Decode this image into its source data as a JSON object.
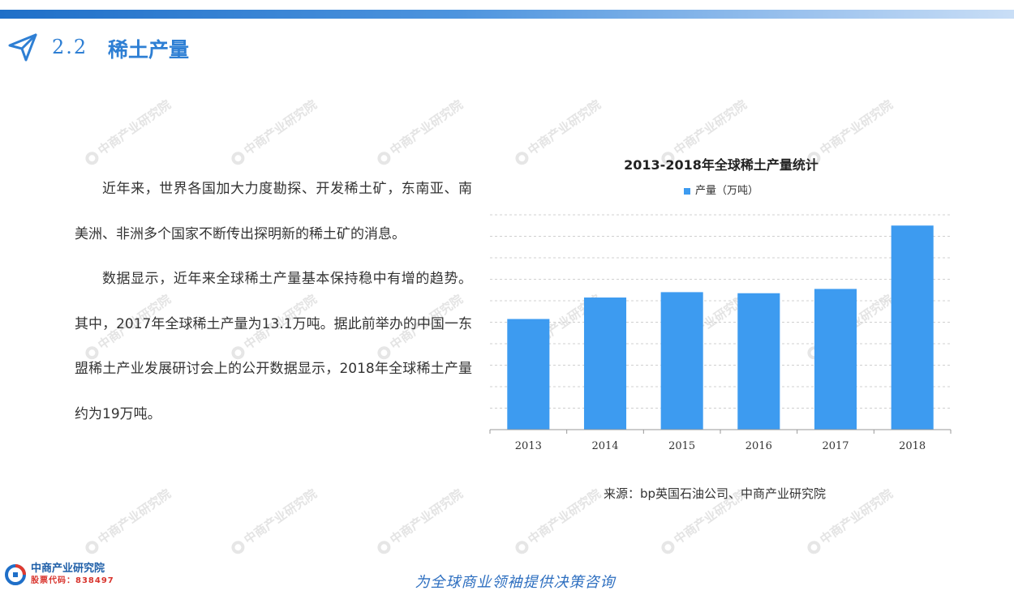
{
  "header": {
    "section_number": "2.2",
    "section_title": "稀土产量"
  },
  "body": {
    "paragraphs": [
      "近年来，世界各国加大力度勘探、开发稀土矿，东南亚、南美洲、非洲多个国家不断传出探明新的稀土矿的消息。",
      "数据显示，近年来全球稀土产量基本保持稳中有增的趋势。其中，2017年全球稀土产量为13.1万吨。据此前举办的中国一东盟稀土产业发展研讨会上的公开数据显示，2018年全球稀土产量约为19万吨。"
    ]
  },
  "chart_data": {
    "type": "bar",
    "title": "2013-2018年全球稀土产量统计",
    "categories": [
      "2013",
      "2014",
      "2015",
      "2016",
      "2017",
      "2018"
    ],
    "series": [
      {
        "name": "产量（万吨）",
        "values": [
          10.3,
          12.3,
          12.8,
          12.7,
          13.1,
          19.0
        ]
      }
    ],
    "ylim": [
      0,
      20
    ],
    "gridlines": true,
    "legend_position": "top",
    "bar_color": "#3d9bf0"
  },
  "source": "来源：bp英国石油公司、中商产业研究院",
  "footer": {
    "logo_name": "中商产业研究院",
    "stock_code": "股票代码：838497",
    "slogan": "为全球商业领袖提供决策咨询"
  },
  "watermark": {
    "text": "中商产业研究院"
  },
  "colors": {
    "accent": "#2e7fd4",
    "bar": "#3d9bf0"
  }
}
